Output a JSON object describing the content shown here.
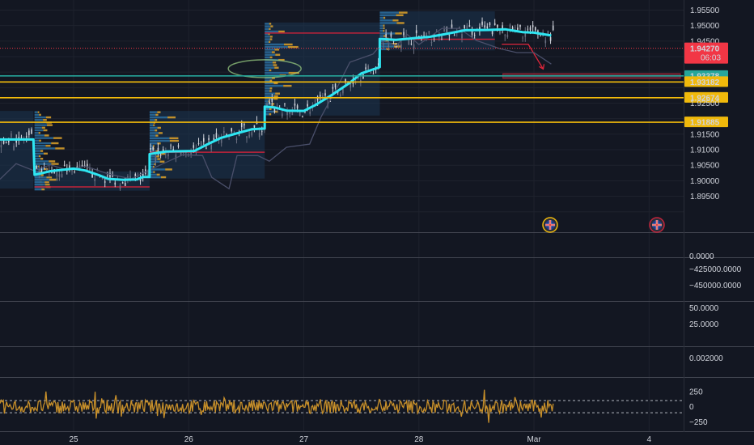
{
  "chart_data": [
    {
      "type": "line",
      "pane": "price",
      "ylim": [
        1.8868,
        1.9572
      ],
      "y_ticks": [
        "1.95500",
        "1.95000",
        "1.94500",
        "1.94270",
        "1.93500",
        "1.93378",
        "1.93182",
        "1.92674",
        "1.92500",
        "1.91885",
        "1.91500",
        "1.91000",
        "1.90500",
        "1.90000",
        "1.89500"
      ],
      "y_tick_values": [
        1.955,
        1.95,
        1.945,
        1.9427,
        1.935,
        1.93378,
        1.93182,
        1.92674,
        1.925,
        1.91885,
        1.915,
        1.91,
        1.905,
        1.9,
        1.895
      ],
      "hidden_ticks": [
        "1.93500",
        "1.92000"
      ],
      "x_labels": [
        {
          "label": "25",
          "x": 25
        },
        {
          "label": "26",
          "x": 26
        },
        {
          "label": "27",
          "x": 27
        },
        {
          "label": "28",
          "x": 28
        },
        {
          "label": "Mar",
          "x": 29
        },
        {
          "label": "4",
          "x": 30
        }
      ],
      "x_range": [
        24.36,
        30.3
      ],
      "grid": true,
      "price_label": {
        "value": "1.94270",
        "countdown": "06:03",
        "color": "#f23645"
      },
      "horizontal_levels": [
        {
          "value": 1.93378,
          "label": "1.93378",
          "color": "#26a69a"
        },
        {
          "value": 1.93182,
          "label": "1.93182",
          "color": "#f0b90b"
        },
        {
          "value": 1.92674,
          "label": "1.92674",
          "color": "#f0b90b"
        },
        {
          "value": 1.91885,
          "label": "1.91885",
          "color": "#f0b90b"
        }
      ],
      "series": [
        {
          "role": "moving-average",
          "color": "#2ee6f2",
          "points": [
            [
              24.36,
              1.9133
            ],
            [
              24.65,
              1.9133
            ],
            [
              24.66,
              1.9019
            ],
            [
              24.8,
              1.9031
            ],
            [
              25.0,
              1.9039
            ],
            [
              25.1,
              1.9033
            ],
            [
              25.22,
              1.9018
            ],
            [
              25.3,
              1.9006
            ],
            [
              25.43,
              1.9003
            ],
            [
              25.55,
              1.9004
            ],
            [
              25.6,
              1.9012
            ],
            [
              25.66,
              1.9012
            ],
            [
              25.66,
              1.9086
            ],
            [
              25.8,
              1.9094
            ],
            [
              26.05,
              1.9096
            ],
            [
              26.15,
              1.9115
            ],
            [
              26.28,
              1.9138
            ],
            [
              26.4,
              1.9151
            ],
            [
              26.55,
              1.9166
            ],
            [
              26.66,
              1.9168
            ],
            [
              26.66,
              1.9239
            ],
            [
              26.75,
              1.9236
            ],
            [
              26.85,
              1.9226
            ],
            [
              27.0,
              1.9225
            ],
            [
              27.1,
              1.9244
            ],
            [
              27.25,
              1.9278
            ],
            [
              27.4,
              1.9316
            ],
            [
              27.5,
              1.9346
            ],
            [
              27.66,
              1.9366
            ],
            [
              27.66,
              1.9457
            ],
            [
              27.8,
              1.9454
            ],
            [
              27.95,
              1.9459
            ],
            [
              28.1,
              1.9464
            ],
            [
              28.22,
              1.9472
            ],
            [
              28.4,
              1.9485
            ],
            [
              28.6,
              1.9486
            ],
            [
              28.75,
              1.9488
            ],
            [
              28.9,
              1.9479
            ],
            [
              29.0,
              1.9477
            ],
            [
              29.15,
              1.9468
            ]
          ]
        },
        {
          "role": "comparison-line",
          "color": "#4a4f6a",
          "points": [
            [
              24.36,
              1.9005
            ],
            [
              24.5,
              1.9055
            ],
            [
              24.65,
              1.9033
            ],
            [
              24.8,
              1.9051
            ],
            [
              24.95,
              1.9034
            ],
            [
              25.1,
              1.9047
            ],
            [
              25.3,
              1.9022
            ],
            [
              25.5,
              1.9006
            ],
            [
              25.7,
              1.9042
            ],
            [
              25.95,
              1.9084
            ],
            [
              26.12,
              1.9081
            ],
            [
              26.2,
              1.9011
            ],
            [
              26.35,
              1.8974
            ],
            [
              26.42,
              1.9081
            ],
            [
              26.6,
              1.9081
            ],
            [
              26.7,
              1.9063
            ],
            [
              26.85,
              1.9108
            ],
            [
              27.05,
              1.9118
            ],
            [
              27.15,
              1.9206
            ],
            [
              27.3,
              1.9308
            ],
            [
              27.4,
              1.9382
            ],
            [
              27.6,
              1.9408
            ],
            [
              27.7,
              1.9451
            ],
            [
              27.8,
              1.9435
            ],
            [
              27.9,
              1.9471
            ],
            [
              28.0,
              1.9439
            ],
            [
              28.2,
              1.9491
            ],
            [
              28.35,
              1.9491
            ],
            [
              28.5,
              1.9452
            ],
            [
              28.7,
              1.9426
            ],
            [
              28.85,
              1.9413
            ],
            [
              29.0,
              1.9413
            ],
            [
              29.15,
              1.9376
            ]
          ]
        }
      ]
    },
    {
      "type": "line",
      "pane": "indicator-1",
      "y_ticks": [
        "0.0000",
        "−425000.0000",
        "−450000.0000"
      ]
    },
    {
      "type": "line",
      "pane": "indicator-2",
      "y_ticks": [
        "50.0000",
        "25.0000"
      ]
    },
    {
      "type": "line",
      "pane": "indicator-3",
      "y_ticks": [
        "0.002000"
      ]
    },
    {
      "type": "line",
      "pane": "oscillator",
      "ylim": [
        -350,
        420
      ],
      "y_ticks": [
        "250",
        "0",
        "−250"
      ],
      "y_tick_values": [
        250,
        0,
        -250
      ],
      "bands": [
        {
          "value": 100,
          "color": "#b2b5be"
        },
        {
          "value": -100,
          "color": "#b2b5be"
        }
      ],
      "series": [
        {
          "color": "#c8902a"
        }
      ]
    }
  ]
}
